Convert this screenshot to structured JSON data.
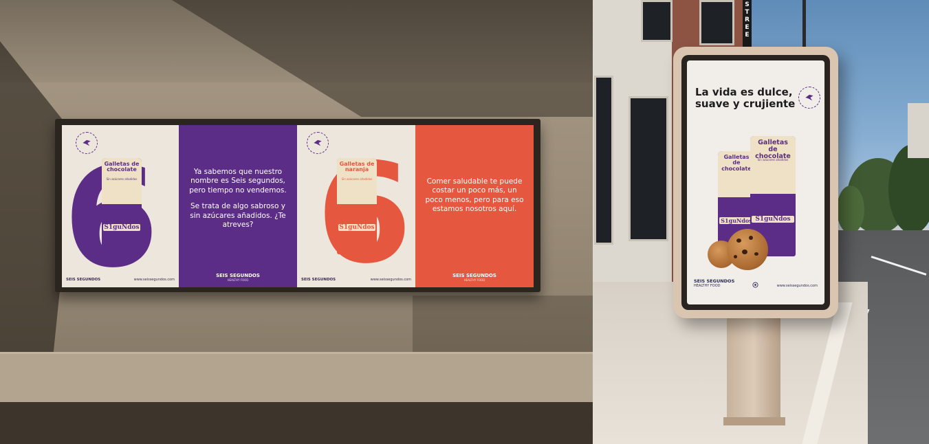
{
  "left_scene": {
    "poster1": {
      "seal_text": "SIN AZÚCARES AÑADIDOS",
      "can_title": "Galletas de chocolate",
      "can_subtitle": "Sin azúcares añadidos",
      "can_brand": "S1guNdos",
      "big_numeral": "6",
      "footer_brand": "SEIS SEGUNDOS",
      "footer_url": "www.seissegundos.com"
    },
    "poster2": {
      "paragraph1": "Ya sabemos que nuestro nombre es Seis segundos, pero tiempo no vendemos.",
      "paragraph2": "Se trata de algo sabroso y sin azúcares añadidos. ¿Te atreves?",
      "footer_brand": "SEIS SEGUNDOS",
      "footer_sub": "HEALTHY FOOD"
    },
    "poster3": {
      "seal_text": "SIN AZÚCARES AÑADIDOS",
      "can_title": "Galletas de naranja",
      "can_subtitle": "Sin azúcares añadidos",
      "can_brand": "S1guNdos",
      "big_numeral": "6",
      "footer_brand": "SEIS SEGUNDOS",
      "footer_url": "www.seissegundos.com"
    },
    "poster4": {
      "paragraph1": "Comer saludable te puede costar un poco más, un poco menos, pero para eso estamos nosotros aquí.",
      "footer_brand": "SEIS SEGUNDOS",
      "footer_sub": "HEALTHY FOOD"
    }
  },
  "right_scene": {
    "street_sign": "STREE",
    "headline_line1": "La vida es dulce,",
    "headline_line2": "suave y crujiente",
    "can_front_title": "Galletas de chocolate",
    "can_back_title": "Galletas de chocolate",
    "can_subtitle": "Sin azúcares añadidos",
    "can_brand": "S1guNdos",
    "footer_brand": "SEIS SEGUNDOS",
    "footer_sub": "HEALTHY FOOD",
    "footer_url": "www.seissegundos.com"
  },
  "colors": {
    "purple": "#5b2d86",
    "orange": "#e5573f",
    "cream": "#ece6dc",
    "can_cream": "#efe1c6"
  }
}
